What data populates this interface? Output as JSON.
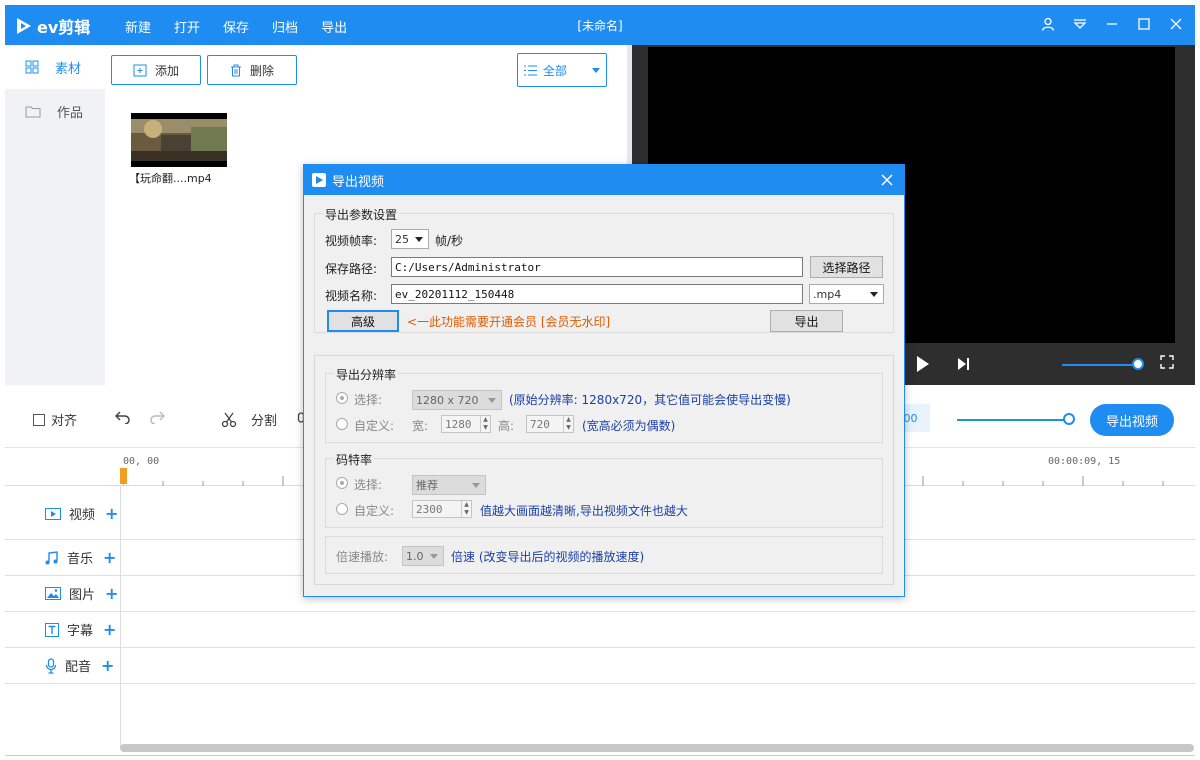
{
  "app": {
    "logo_text": "ev剪辑",
    "window_title": "[未命名]",
    "menu": [
      "新建",
      "打开",
      "保存",
      "归档",
      "导出"
    ]
  },
  "sidebar": {
    "items": [
      {
        "label": "素材",
        "icon": "grid-icon",
        "active": true
      },
      {
        "label": "作品",
        "icon": "folder-icon",
        "active": false
      }
    ]
  },
  "assets": {
    "add_label": "添加",
    "delete_label": "删除",
    "filter_value": "全部",
    "clip_name": "【玩命翻....mp4"
  },
  "toolbar": {
    "align_label": "对齐",
    "split_label": "分割",
    "time_fragment": ".00",
    "export_label": "导出视频"
  },
  "timeline": {
    "start_time": "00, 00",
    "end_time": "00:00:09, 15",
    "tracks": [
      {
        "label": "视频",
        "icon": "video-icon"
      },
      {
        "label": "音乐",
        "icon": "music-icon"
      },
      {
        "label": "图片",
        "icon": "image-icon"
      },
      {
        "label": "字幕",
        "icon": "text-icon"
      },
      {
        "label": "配音",
        "icon": "mic-icon"
      }
    ]
  },
  "dialog": {
    "title": "导出视频",
    "params_group": "导出参数设置",
    "fps_label": "视频帧率:",
    "fps_value": "25",
    "fps_unit": "帧/秒",
    "path_label": "保存路径:",
    "path_value": "C:/Users/Administrator",
    "choose_path": "选择路径",
    "name_label": "视频名称:",
    "name_value": "ev_20201112_150448",
    "ext_value": ".mp4",
    "advanced": "高级",
    "member_note": "<一此功能需要开通会员 [会员无水印]",
    "export": "导出",
    "resolution_group": "导出分辨率",
    "select_label": "选择:",
    "resolution_value": "1280 x 720",
    "resolution_note": "(原始分辨率: 1280x720，其它值可能会使导出变慢)",
    "custom_label": "自定义:",
    "width_label": "宽:",
    "width_value": "1280",
    "height_label": "高:",
    "height_value": "720",
    "even_note": "(宽高必须为偶数)",
    "bitrate_group": "码特率",
    "bitrate_select": "推荐",
    "bitrate_custom": "2300",
    "bitrate_note": "值越大画面越清晰,导出视频文件也越大",
    "speed_label": "倍速播放:",
    "speed_value": "1.0",
    "speed_note": "倍速 (改变导出后的视频的播放速度)"
  },
  "colors": {
    "accent": "#1e8cf0",
    "preview_bg": "#2e2e2e",
    "note_blue": "#1a3fa6",
    "note_orange": "#e05a00"
  }
}
